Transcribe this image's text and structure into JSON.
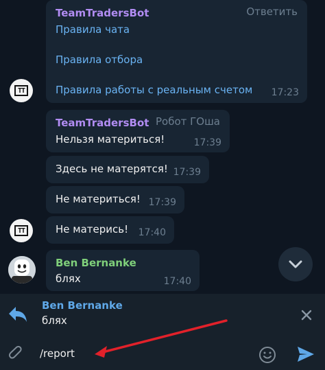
{
  "messages": {
    "m1": {
      "sender": "TeamTradersBot",
      "reply_action": "Ответить",
      "links": [
        "Правила чата",
        "Правила отбора",
        "Правила работы с реальным счетом"
      ],
      "time": "17:23"
    },
    "m2": {
      "sender": "TeamTradersBot",
      "sub": "Робот ГОша",
      "text": "Нельзя материться!",
      "time": "17:39"
    },
    "m3": {
      "text": "Здесь не матерятся!",
      "time": "17:39"
    },
    "m4": {
      "text": "Не материться!",
      "time": "17:39"
    },
    "m5": {
      "text": "Не матерись!",
      "time": "17:40"
    },
    "m6": {
      "sender": "Ben Bernanke",
      "text": "блях",
      "time": "17:40"
    }
  },
  "reply": {
    "name": "Ben Bernanke",
    "text": "блях"
  },
  "composer": {
    "value": "/report"
  },
  "colors": {
    "background": "#0e1621",
    "bubble": "#182533",
    "bot_name": "#b18cf2",
    "user_name": "#7fcf7a",
    "link": "#6ab3f3",
    "accent": "#5fa8e8",
    "annotation_arrow": "#e2212a"
  },
  "icons": [
    "reply-icon",
    "close-icon",
    "attach-icon",
    "emoji-icon",
    "send-icon",
    "chevron-down-icon"
  ]
}
